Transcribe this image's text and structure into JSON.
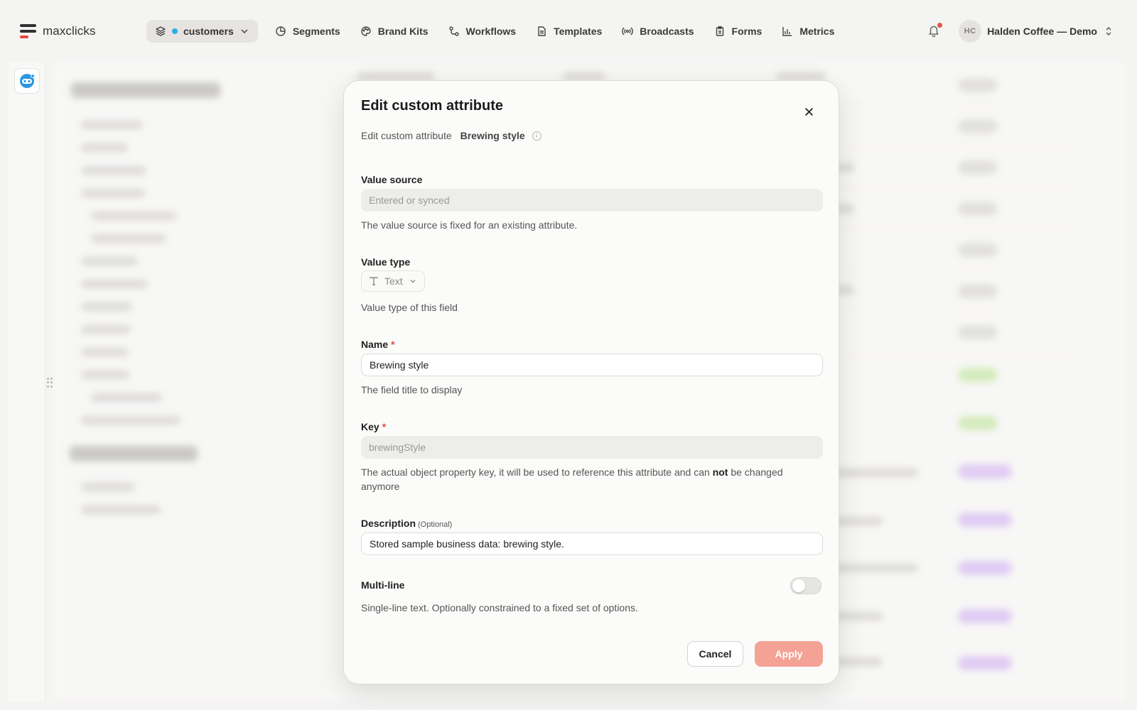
{
  "app": {
    "name": "maxclicks"
  },
  "nav": {
    "workspace": "customers",
    "items": [
      {
        "label": "Segments",
        "icon": "segments-icon"
      },
      {
        "label": "Brand Kits",
        "icon": "palette-icon"
      },
      {
        "label": "Workflows",
        "icon": "workflow-icon"
      },
      {
        "label": "Templates",
        "icon": "document-icon"
      },
      {
        "label": "Broadcasts",
        "icon": "broadcast-icon"
      },
      {
        "label": "Forms",
        "icon": "clipboard-icon"
      },
      {
        "label": "Metrics",
        "icon": "bar-chart-icon"
      }
    ]
  },
  "account": {
    "initials": "HC",
    "name": "Halden Coffee — Demo"
  },
  "modal": {
    "title": "Edit custom attribute",
    "subtitle_prefix": "Edit custom attribute",
    "subtitle_name": "Brewing style",
    "value_source": {
      "label": "Value source",
      "placeholder": "Entered or synced",
      "help": "The value source is fixed for an existing attribute."
    },
    "value_type": {
      "label": "Value type",
      "selected": "Text",
      "help": "Value type of this field"
    },
    "name": {
      "label": "Name",
      "required_mark": "*",
      "value": "Brewing style",
      "help": "The field title to display"
    },
    "key": {
      "label": "Key",
      "required_mark": "*",
      "value": "brewingStyle",
      "help_before": "The actual object property key, it will be used to reference this attribute and can ",
      "help_bold": "not",
      "help_after": " be changed anymore"
    },
    "description": {
      "label": "Description",
      "optional": "(Optional)",
      "value": "Stored sample business data: brewing style."
    },
    "multiline": {
      "label": "Multi-line",
      "enabled": false,
      "help": "Single-line text. Optionally constrained to a fixed set of options."
    },
    "cancel_label": "Cancel",
    "apply_label": "Apply"
  },
  "colors": {
    "accent": "#e6392e",
    "apply_disabled": "#f4a196",
    "workspace_dot": "#18a9e0"
  }
}
